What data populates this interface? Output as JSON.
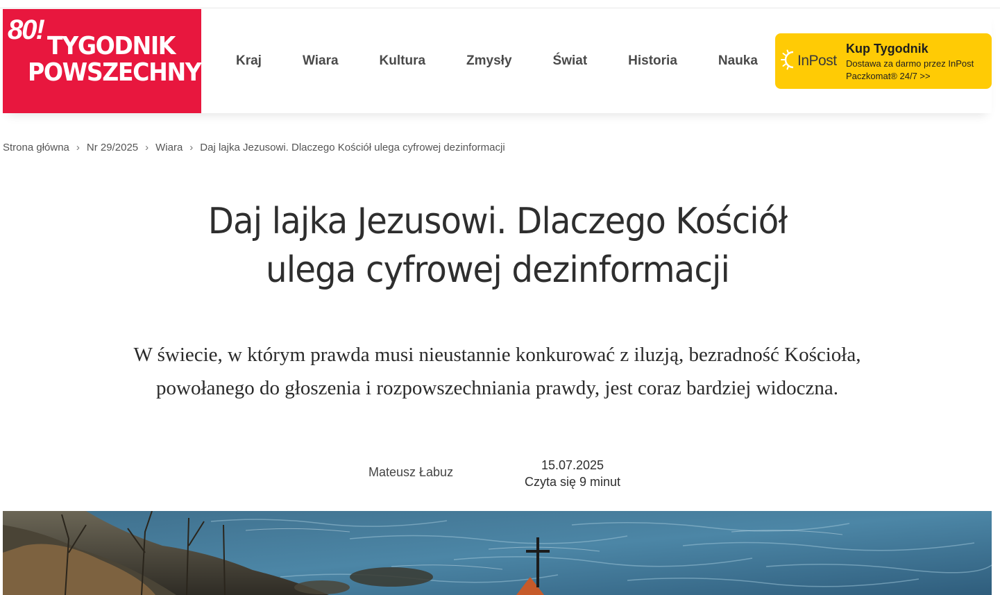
{
  "logo": {
    "number": "80!",
    "line1": "TYGODNIK",
    "line2": "POWSZECHNY",
    "color": "#e8173e"
  },
  "nav": {
    "items": [
      {
        "label": "Kraj"
      },
      {
        "label": "Wiara"
      },
      {
        "label": "Kultura"
      },
      {
        "label": "Zmysły"
      },
      {
        "label": "Świat"
      },
      {
        "label": "Historia"
      },
      {
        "label": "Nauka"
      }
    ]
  },
  "promo": {
    "logo_text": "InPost",
    "title": "Kup Tygodnik",
    "text": "Dostawa za darmo przez InPost Paczkomat® 24/7 >>",
    "color": "#ffcb05"
  },
  "breadcrumb": {
    "items": [
      "Strona główna",
      "Nr 29/2025",
      "Wiara"
    ],
    "current": "Daj lajka Jezusowi. Dlaczego Kościół ulega cyfrowej dezinformacji",
    "separator": "›"
  },
  "article": {
    "title": "Daj lajka Jezusowi. Dlaczego Kościół ulega cyfrowej dezinformacji",
    "lead": "W świecie, w którym prawda musi nieustannie konkurować z iluzją, bezradność Kościoła, powołanego do głoszenia i rozpowszechniania prawdy, jest coraz bardziej widoczna.",
    "author": "Mateusz Łabuz",
    "date": "15.07.2025",
    "reading_time": "Czyta się 9 minut"
  }
}
